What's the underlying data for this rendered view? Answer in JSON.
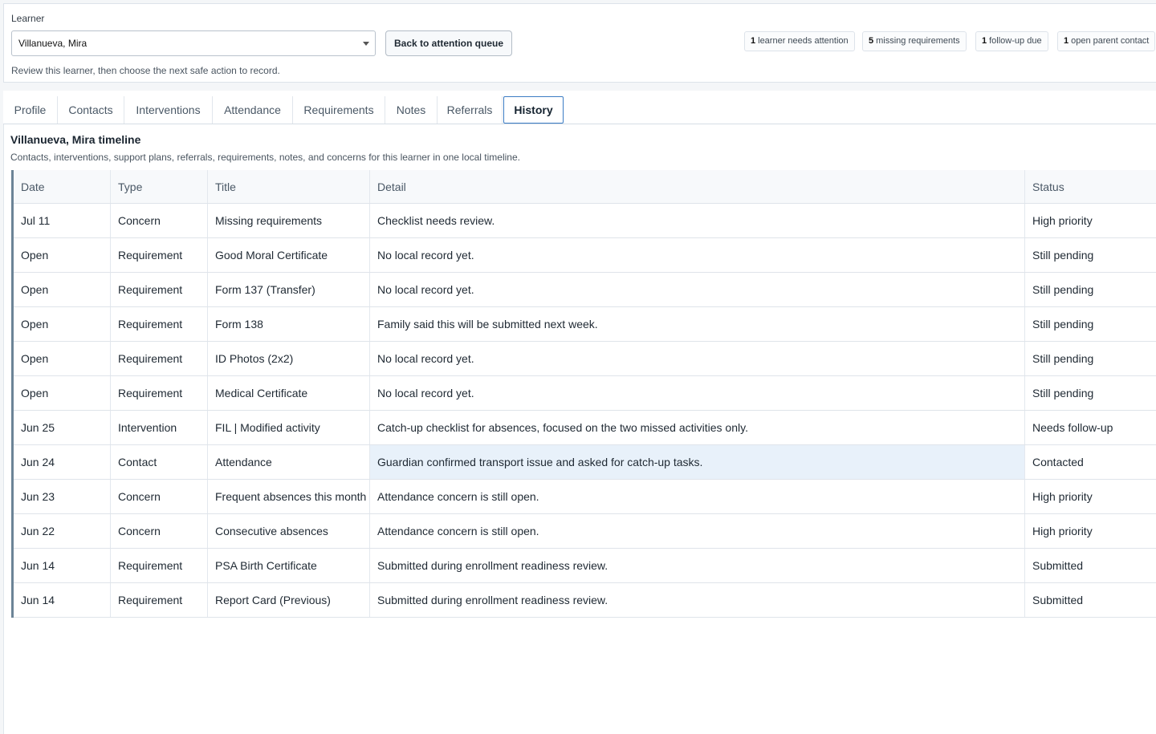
{
  "learner": {
    "label": "Learner",
    "selected": "Villanueva, Mira",
    "helper": "Review this learner, then choose the next safe action to record."
  },
  "actions": {
    "back_label": "Back to attention queue"
  },
  "badges": [
    {
      "count": "1",
      "label": "learner needs attention"
    },
    {
      "count": "5",
      "label": "missing requirements"
    },
    {
      "count": "1",
      "label": "follow-up due"
    },
    {
      "count": "1",
      "label": "open parent contact"
    }
  ],
  "tabs": [
    {
      "label": "Profile",
      "active": false
    },
    {
      "label": "Contacts",
      "active": false
    },
    {
      "label": "Interventions",
      "active": false
    },
    {
      "label": "Attendance",
      "active": false
    },
    {
      "label": "Requirements",
      "active": false
    },
    {
      "label": "Notes",
      "active": false
    },
    {
      "label": "Referrals",
      "active": false
    },
    {
      "label": "History",
      "active": true
    }
  ],
  "timeline": {
    "title": "Villanueva, Mira timeline",
    "subtitle": "Contacts, interventions, support plans, referrals, requirements, notes, and concerns for this learner in one local timeline.",
    "columns": {
      "date": "Date",
      "type": "Type",
      "title": "Title",
      "detail": "Detail",
      "status": "Status"
    },
    "rows": [
      {
        "date": "Jul 11",
        "type": "Concern",
        "title": "Missing requirements",
        "detail": "Checklist needs review.",
        "status": "High priority"
      },
      {
        "date": "Open",
        "type": "Requirement",
        "title": "Good Moral Certificate",
        "detail": "No local record yet.",
        "status": "Still pending"
      },
      {
        "date": "Open",
        "type": "Requirement",
        "title": "Form 137 (Transfer)",
        "detail": "No local record yet.",
        "status": "Still pending"
      },
      {
        "date": "Open",
        "type": "Requirement",
        "title": "Form 138",
        "detail": "Family said this will be submitted next week.",
        "status": "Still pending"
      },
      {
        "date": "Open",
        "type": "Requirement",
        "title": "ID Photos (2x2)",
        "detail": "No local record yet.",
        "status": "Still pending"
      },
      {
        "date": "Open",
        "type": "Requirement",
        "title": "Medical Certificate",
        "detail": "No local record yet.",
        "status": "Still pending"
      },
      {
        "date": "Jun 25",
        "type": "Intervention",
        "title": "FIL | Modified activity",
        "detail": "Catch-up checklist for absences, focused on the two missed activities only.",
        "status": "Needs follow-up"
      },
      {
        "date": "Jun 24",
        "type": "Contact",
        "title": "Attendance",
        "detail": "Guardian confirmed transport issue and asked for catch-up tasks.",
        "status": "Contacted",
        "highlight": true
      },
      {
        "date": "Jun 23",
        "type": "Concern",
        "title": "Frequent absences this month",
        "detail": "Attendance concern is still open.",
        "status": "High priority"
      },
      {
        "date": "Jun 22",
        "type": "Concern",
        "title": "Consecutive absences",
        "detail": "Attendance concern is still open.",
        "status": "High priority"
      },
      {
        "date": "Jun 14",
        "type": "Requirement",
        "title": "PSA Birth Certificate",
        "detail": "Submitted during enrollment readiness review.",
        "status": "Submitted"
      },
      {
        "date": "Jun 14",
        "type": "Requirement",
        "title": "Report Card (Previous)",
        "detail": "Submitted during enrollment readiness review.",
        "status": "Submitted"
      }
    ]
  },
  "colors": {
    "accent": "#3b7cc4",
    "row_highlight": "#e8f1fa",
    "table_edge": "#6c8497"
  }
}
